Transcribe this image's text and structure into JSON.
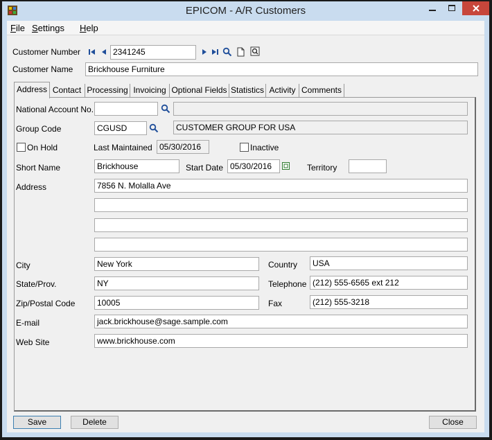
{
  "window": {
    "title": "EPICOM - A/R Customers"
  },
  "menu": {
    "file": "File",
    "settings": "Settings",
    "help": "Help"
  },
  "header": {
    "customer_number_label": "Customer Number",
    "customer_number": "2341245",
    "customer_name_label": "Customer Name",
    "customer_name": "Brickhouse Furniture"
  },
  "tabs": [
    "Address",
    "Contact",
    "Processing",
    "Invoicing",
    "Optional Fields",
    "Statistics",
    "Activity",
    "Comments"
  ],
  "address": {
    "national_account_label": "National Account No.",
    "national_account": "",
    "national_account_desc": "",
    "group_code_label": "Group Code",
    "group_code": "CGUSD",
    "group_code_desc": "CUSTOMER GROUP FOR USA",
    "on_hold_label": "On Hold",
    "last_maintained_label": "Last Maintained",
    "last_maintained": "05/30/2016",
    "inactive_label": "Inactive",
    "short_name_label": "Short Name",
    "short_name": "Brickhouse",
    "start_date_label": "Start Date",
    "start_date": "05/30/2016",
    "territory_label": "Territory",
    "territory": "",
    "address_label": "Address",
    "address_line1": "7856 N. Molalla Ave",
    "address_line2": "",
    "address_line3": "",
    "address_line4": "",
    "city_label": "City",
    "city": "New York",
    "country_label": "Country",
    "country": "USA",
    "state_label": "State/Prov.",
    "state": "NY",
    "telephone_label": "Telephone",
    "telephone": "(212) 555-6565 ext 212",
    "zip_label": "Zip/Postal Code",
    "zip": "10005",
    "fax_label": "Fax",
    "fax": "(212) 555-3218",
    "email_label": "E-mail",
    "email": "jack.brickhouse@sage.sample.com",
    "website_label": "Web Site",
    "website": "www.brickhouse.com"
  },
  "buttons": {
    "save": "Save",
    "delete": "Delete",
    "close": "Close"
  },
  "icons": [
    "first-record-icon",
    "previous-record-icon",
    "next-record-icon",
    "last-record-icon",
    "search-icon",
    "new-document-icon",
    "zoom-icon",
    "calendar-icon"
  ],
  "colors": {
    "window_frame": "#c9dcef",
    "close_button": "#c7463b",
    "nav_arrows": "#1f4e9a"
  }
}
